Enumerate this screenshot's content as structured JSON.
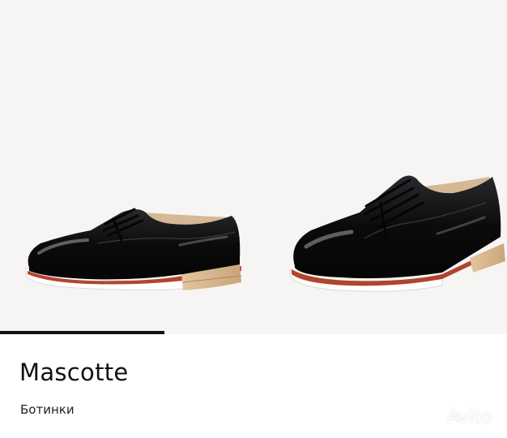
{
  "listing": {
    "brand": "Mascotte",
    "category": "Ботинки"
  },
  "gallery": {
    "progress": 0.325,
    "watermark_text": "Avito"
  },
  "colors": {
    "background": "#f6f5f3",
    "shoe": "#0b0b0c",
    "sole_white": "#ffffff",
    "sole_red": "#b0452c",
    "heel_wood": "#d8b48b",
    "lining": "#d6b894",
    "text": "#111111"
  },
  "icons": {
    "watermark": "avito-logo-icon"
  }
}
